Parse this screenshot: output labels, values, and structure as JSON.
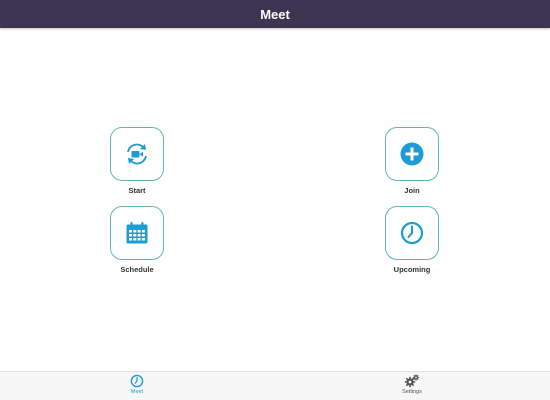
{
  "header": {
    "title": "Meet"
  },
  "tiles": {
    "start": {
      "label": "Start",
      "icon": "video-camera-refresh-icon"
    },
    "join": {
      "label": "Join",
      "icon": "plus-circle-icon"
    },
    "schedule": {
      "label": "Schedule",
      "icon": "calendar-icon"
    },
    "upcoming": {
      "label": "Upcoming",
      "icon": "clock-icon"
    }
  },
  "bottom_nav": {
    "meet": {
      "label": "Meet",
      "icon": "clock-icon",
      "active": true
    },
    "settings": {
      "label": "Settings",
      "icon": "gear-icon",
      "active": false
    }
  },
  "colors": {
    "header_bg": "#3d3552",
    "accent": "#1d9bd6",
    "tile_border": "#62b6b3"
  }
}
